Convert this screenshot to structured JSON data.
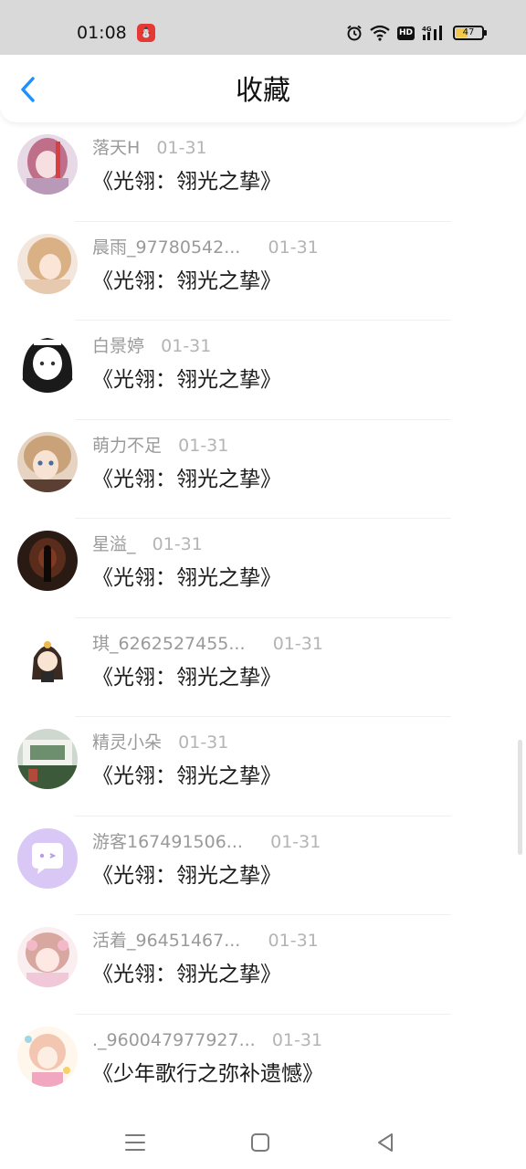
{
  "status_bar": {
    "time": "01:08",
    "app_icon_glyph": "⛄",
    "battery": "47",
    "battery_level": 0.47,
    "icons": [
      "alarm-icon",
      "wifi-icon",
      "hd-badge",
      "cellular-4g-icon",
      "battery-icon"
    ],
    "hd_label": "HD"
  },
  "header": {
    "title": "收藏",
    "back_icon": "chevron-left-icon"
  },
  "colors": {
    "accent": "#1e90ff",
    "meta_text": "#9a9a9a",
    "title_text": "#1a1a1a",
    "status_bg": "#d9d9d9"
  },
  "favorites": [
    {
      "name": "落天H",
      "date": "01-31",
      "title": "《光翎：翎光之挚》"
    },
    {
      "name": "晨雨_97780542...",
      "date": "01-31",
      "title": "《光翎：翎光之挚》"
    },
    {
      "name": "白景婷",
      "date": "01-31",
      "title": "《光翎：翎光之挚》"
    },
    {
      "name": "萌力不足",
      "date": "01-31",
      "title": "《光翎：翎光之挚》"
    },
    {
      "name": "星溢_",
      "date": "01-31",
      "title": "《光翎：翎光之挚》"
    },
    {
      "name": "琪_6262527455...",
      "date": "01-31",
      "title": "《光翎：翎光之挚》"
    },
    {
      "name": "精灵小朵",
      "date": "01-31",
      "title": "《光翎：翎光之挚》"
    },
    {
      "name": "游客167491506...",
      "date": "01-31",
      "title": "《光翎：翎光之挚》"
    },
    {
      "name": "活着_96451467...",
      "date": "01-31",
      "title": "《光翎：翎光之挚》"
    },
    {
      "name": "._960047977927...",
      "date": "01-31",
      "title": "《少年歌行之弥补遗憾》"
    }
  ],
  "nav_bar": {
    "items": [
      "menu-icon",
      "home-square-icon",
      "back-triangle-icon"
    ]
  }
}
